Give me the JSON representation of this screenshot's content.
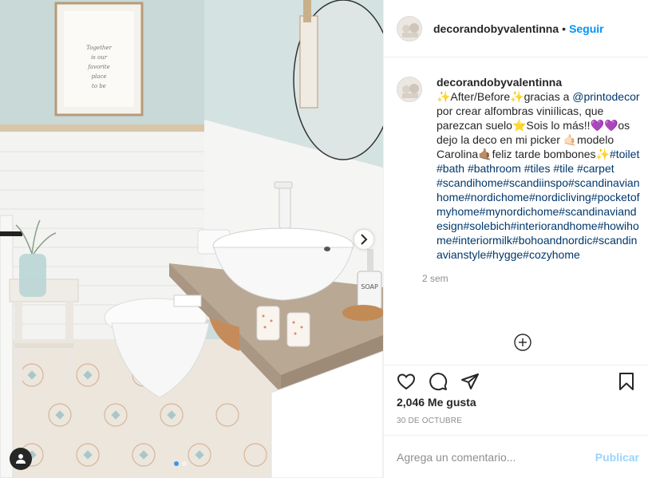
{
  "post": {
    "username": "decorandobyvalentinna",
    "separator": "•",
    "follow_label": "Seguir",
    "caption_segments": [
      {
        "text": "✨After/Before✨gracias a ",
        "type": "text"
      },
      {
        "text": "@printodecor",
        "type": "link"
      },
      {
        "text": " por crear alfombras viniílicas, que parezcan suelo⭐Sois lo más!!💜💜os dejo la deco en mi picker 🤙🏻modelo Carolina🤙🏽feliz tarde bombones✨",
        "type": "text"
      },
      {
        "text": "#toilet",
        "type": "link"
      },
      {
        "text": " ",
        "type": "text"
      },
      {
        "text": "#bath",
        "type": "link"
      },
      {
        "text": " ",
        "type": "text"
      },
      {
        "text": "#bathroom",
        "type": "link"
      },
      {
        "text": " ",
        "type": "text"
      },
      {
        "text": "#tiles",
        "type": "link"
      },
      {
        "text": " ",
        "type": "text"
      },
      {
        "text": "#tile",
        "type": "link"
      },
      {
        "text": " ",
        "type": "text"
      },
      {
        "text": "#carpet",
        "type": "link"
      },
      {
        "text": " ",
        "type": "text"
      },
      {
        "text": "#scandihome#scandiinspo#scandinavianhome#nordichome#nordicliving#pocketofmyhome#mynordichome#scandinaviandesign#solebich#interiorandhome#howihome#interiormilk#bohoandnordic#scandinavianstyle#hygge#cozyhome",
        "type": "link"
      }
    ],
    "time_ago": "2 sem",
    "likes": "2,046 Me gusta",
    "date": "30 DE OCTUBRE",
    "comment_placeholder": "Agrega un comentario...",
    "publish_label": "Publicar"
  },
  "photo": {
    "poster_text": "Together is our favorite place to be",
    "soap_label": "SOAP"
  },
  "icons": {
    "like": "heart-icon",
    "comment": "comment-icon",
    "share": "paper-plane-icon",
    "save": "bookmark-icon",
    "load_more": "plus-circle-icon",
    "next": "chevron-right-icon",
    "tag": "user-icon"
  },
  "colors": {
    "accent": "#0095f6",
    "link": "#00376b",
    "muted": "#8e8e8e"
  }
}
